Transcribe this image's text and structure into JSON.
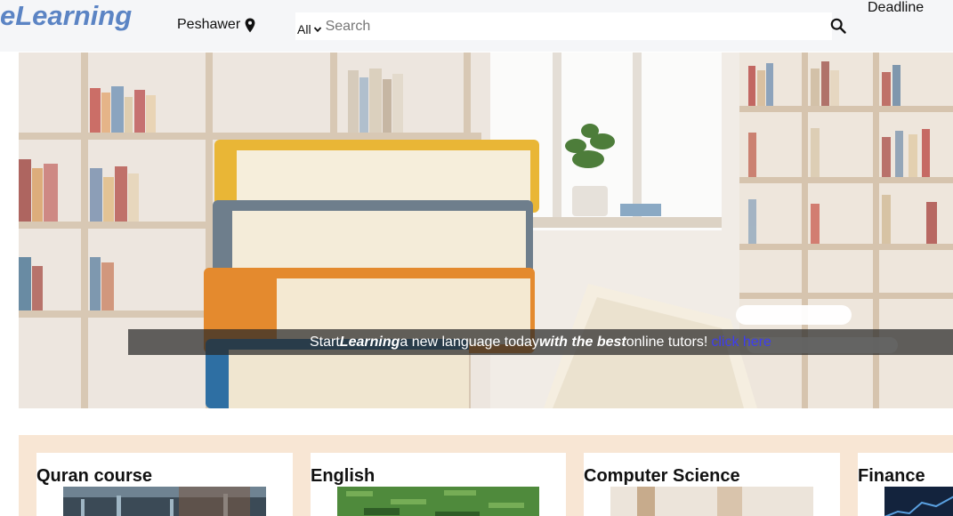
{
  "header": {
    "logo": "eLearning",
    "location": "Peshawer",
    "search_category": "All",
    "search_placeholder": "Search",
    "deadline": "Deadline"
  },
  "hero": {
    "caption_start": "Start ",
    "caption_em1": "Learning",
    "caption_mid": "a new language today ",
    "caption_em2": "with the best",
    "caption_end": " online tutors! ",
    "caption_link": "click here"
  },
  "courses": [
    {
      "title": "Quran course"
    },
    {
      "title": "English"
    },
    {
      "title": "Computer Science"
    },
    {
      "title": "Finance"
    }
  ],
  "colors": {
    "logo": "#5b84c4",
    "link": "#3d3df0",
    "course_strip": "#f8e6d4"
  },
  "icons": [
    "location-pin-icon",
    "chevron-down-icon",
    "search-icon"
  ]
}
